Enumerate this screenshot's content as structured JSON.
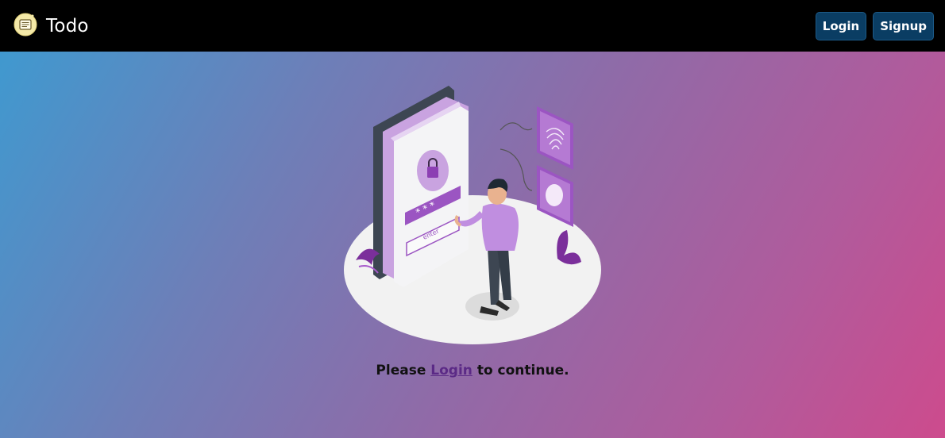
{
  "navbar": {
    "brand_title": "Todo",
    "brand_icon": "notepad-icon",
    "login_label": "Login",
    "signup_label": "Signup"
  },
  "main": {
    "illustration": "security-login-illustration",
    "message_prefix": "Please ",
    "message_link": "Login",
    "message_suffix": " to continue.",
    "phone_input_text": "enter"
  },
  "colors": {
    "navbar_bg": "#000000",
    "button_bg": "#0a3d63",
    "accent_purple": "#9b55c2",
    "gradient_start": "#3c9bd1",
    "gradient_end": "#cd4b8d"
  }
}
